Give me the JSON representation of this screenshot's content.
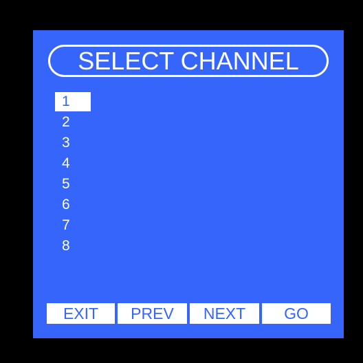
{
  "screen": {
    "title": "SELECT CHANNEL"
  },
  "channels": [
    {
      "label": "1",
      "selected": true
    },
    {
      "label": "2",
      "selected": false
    },
    {
      "label": "3",
      "selected": false
    },
    {
      "label": "4",
      "selected": false
    },
    {
      "label": "5",
      "selected": false
    },
    {
      "label": "6",
      "selected": false
    },
    {
      "label": "7",
      "selected": false
    },
    {
      "label": "8",
      "selected": false
    }
  ],
  "softkeys": {
    "exit": "EXIT",
    "prev": "PREV",
    "next": "NEXT",
    "go": "GO"
  },
  "colors": {
    "bezel": "#000000",
    "screen_background": "#3565fb",
    "foreground": "#ffffff"
  }
}
